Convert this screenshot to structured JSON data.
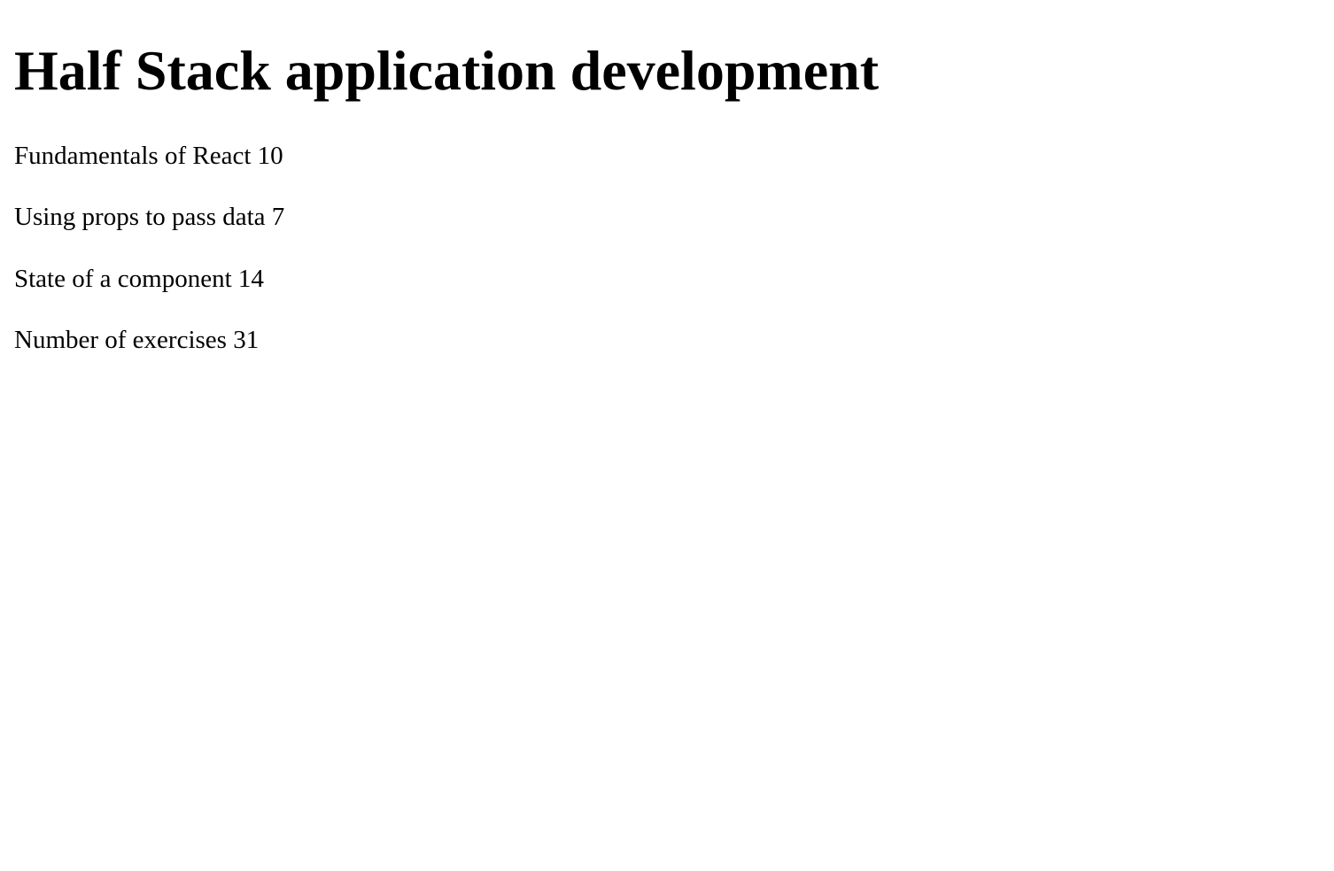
{
  "course": {
    "name": "Half Stack application development"
  },
  "parts": [
    {
      "name": "Fundamentals of React",
      "exercises": "10"
    },
    {
      "name": "Using props to pass data",
      "exercises": "7"
    },
    {
      "name": "State of a component",
      "exercises": "14"
    }
  ],
  "total": {
    "label": "Number of exercises",
    "value": "31"
  }
}
